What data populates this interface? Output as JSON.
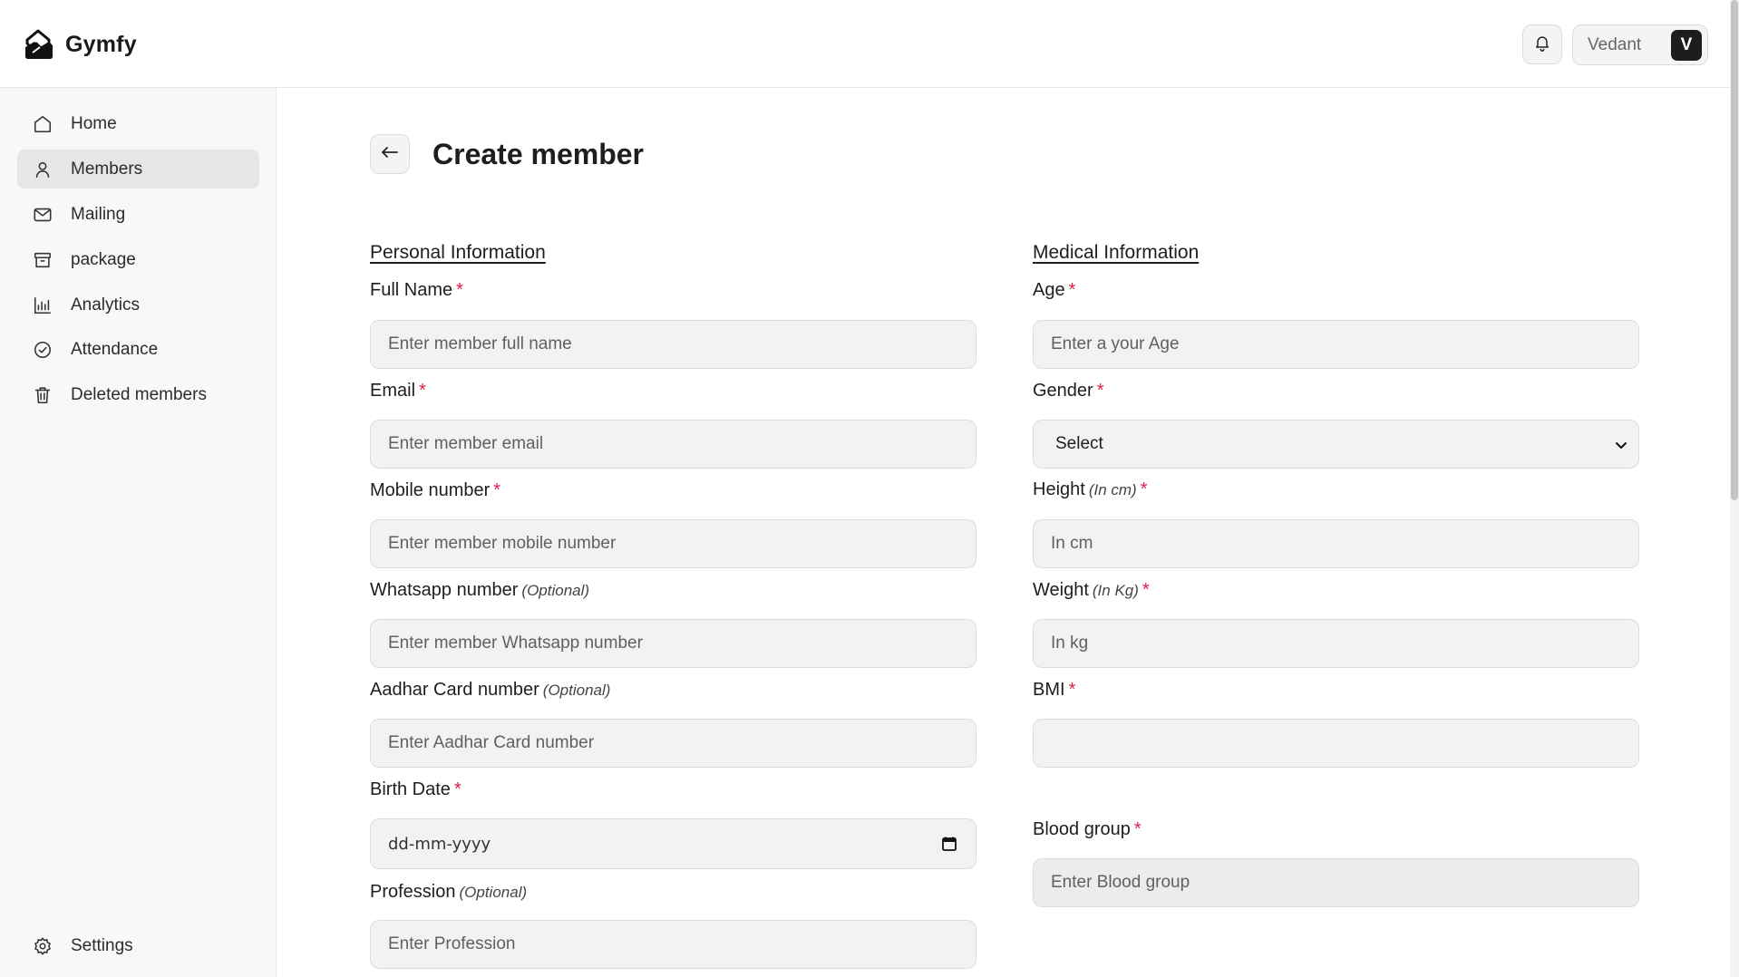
{
  "header": {
    "brand": "Gymfy",
    "user_name": "Vedant",
    "avatar_initial": "V"
  },
  "sidebar": {
    "items": [
      {
        "label": "Home",
        "icon": "home-icon"
      },
      {
        "label": "Members",
        "icon": "user-icon"
      },
      {
        "label": "Mailing",
        "icon": "mail-icon"
      },
      {
        "label": "package",
        "icon": "archive-icon"
      },
      {
        "label": "Analytics",
        "icon": "bar-chart-icon"
      },
      {
        "label": "Attendance",
        "icon": "check-circle-icon"
      },
      {
        "label": "Deleted members",
        "icon": "trash-icon"
      }
    ],
    "settings_label": "Settings",
    "active_item": "Members"
  },
  "page": {
    "title": "Create member"
  },
  "personal": {
    "section_title": "Personal Information",
    "full_name": {
      "label": "Full Name",
      "placeholder": "Enter member full name"
    },
    "email": {
      "label": "Email",
      "placeholder": "Enter member email"
    },
    "mobile": {
      "label": "Mobile number",
      "placeholder": "Enter member mobile number"
    },
    "whatsapp": {
      "label": "Whatsapp number",
      "optional": "(Optional)",
      "placeholder": "Enter member Whatsapp number"
    },
    "aadhar": {
      "label": "Aadhar Card number",
      "optional": "(Optional)",
      "placeholder": "Enter Aadhar Card number"
    },
    "birth_date": {
      "label": "Birth Date",
      "placeholder": "dd-mm-yyyy"
    },
    "profession": {
      "label": "Profession",
      "optional": "(Optional)",
      "placeholder": "Enter Profession"
    }
  },
  "medical": {
    "section_title": "Medical Information",
    "age": {
      "label": "Age",
      "placeholder": "Enter a your Age"
    },
    "gender": {
      "label": "Gender",
      "selected": "Select"
    },
    "height": {
      "label": "Height",
      "unit": "(In cm)",
      "placeholder": "In cm"
    },
    "weight": {
      "label": "Weight",
      "unit": "(In Kg)",
      "placeholder": "In kg"
    },
    "bmi": {
      "label": "BMI",
      "value": ""
    },
    "blood_group": {
      "label": "Blood group",
      "placeholder": "Enter Blood group"
    }
  },
  "required_marker": "*",
  "colors": {
    "required": "#e11d48",
    "active_nav_bg": "#e6e6e6",
    "input_bg": "#f2f2f2"
  }
}
